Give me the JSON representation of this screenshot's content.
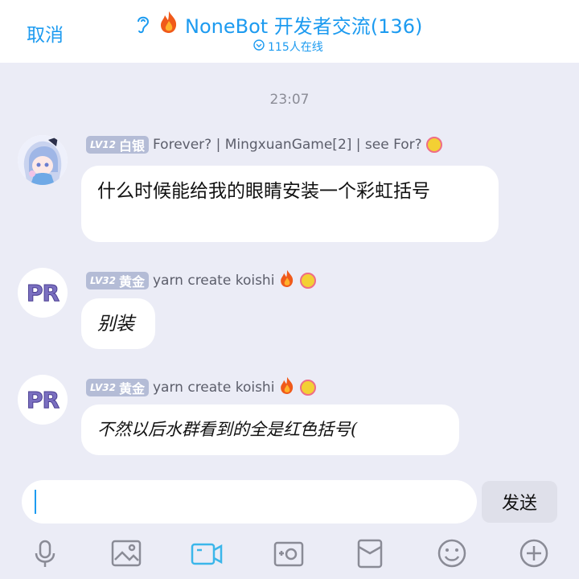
{
  "header": {
    "cancel": "取消",
    "title": "NoneBot 开发者交流(136)",
    "online": "115人在线"
  },
  "chat": {
    "time": "23:07",
    "messages": [
      {
        "level": "LV12",
        "rank": "白银",
        "name": "Forever? | MingxuanGame[2] | see For?",
        "text": "什么时候能给我的眼睛安装一个彩虹括号"
      },
      {
        "level": "LV32",
        "rank": "黄金",
        "name": "yarn create koishi",
        "avatar_text": "PR",
        "text": "别装"
      },
      {
        "level": "LV32",
        "rank": "黄金",
        "name": "yarn create koishi",
        "avatar_text": "PR",
        "text": "不然以后水群看到的全是红色括号("
      }
    ]
  },
  "composer": {
    "value": "",
    "send": "发送"
  },
  "toolbar": [
    "microphone-icon",
    "image-icon",
    "video-icon",
    "camera-icon",
    "red-packet-icon",
    "emoji-icon",
    "plus-icon"
  ],
  "colors": {
    "accent": "#1d9bf0",
    "background": "#ebecf6",
    "badge": "#b4bcd6"
  }
}
